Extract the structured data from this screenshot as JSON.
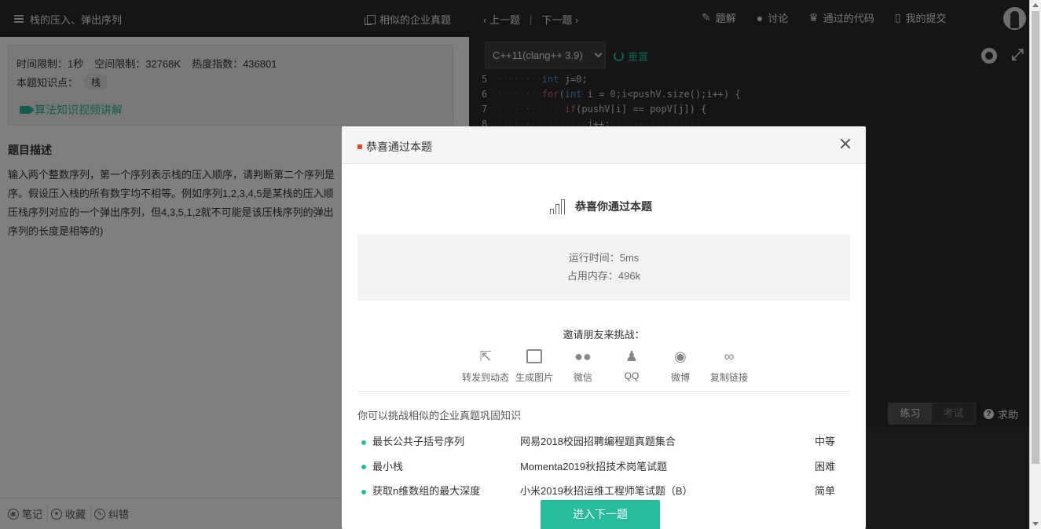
{
  "header": {
    "problem_title": "栈的压入、弹出序列",
    "similar_label": "相似的企业真题",
    "prev_label": "上一题",
    "next_label": "下一题",
    "nav": [
      {
        "label": "题解",
        "icon": "edit-icon"
      },
      {
        "label": "讨论",
        "icon": "chat-icon"
      },
      {
        "label": "通过的代码",
        "icon": "trophy-icon"
      },
      {
        "label": "我的提交",
        "icon": "document-icon"
      }
    ]
  },
  "problem": {
    "time_limit": "时间限制：1秒",
    "space_limit": "空间限制：32768K",
    "heat": "热度指数：436801",
    "knowledge_label": "本题知识点：",
    "knowledge_tag": "栈",
    "video_link": "算法知识视频讲解",
    "desc_title": "题目描述",
    "desc_lines": [
      "输入两个整数序列，第一个序列表示栈的压入顺序，请判断第二个序列是",
      "序。假设压入栈的所有数字均不相等。例如序列1,2,3,4,5是某栈的压入顺",
      "压栈序列对应的一个弹出序列，但4,3,5,1,2就不可能是该压栈序列的弹出",
      "序列的长度是相等的)"
    ]
  },
  "bottom_bar": {
    "note": "笔记",
    "favorite": "收藏",
    "report": "纠错"
  },
  "editor": {
    "language": "C++11(clang++ 3.9)",
    "reset_label": "重置",
    "line_numbers": [
      "5",
      "6",
      "7",
      "8"
    ],
    "practice_label": "练习",
    "exam_label": "考试",
    "help_label": "求助"
  },
  "modal": {
    "title": "恭喜通过本题",
    "success_text": "恭喜你通过本题",
    "runtime": "运行时间：5ms",
    "memory": "占用内存：496k",
    "invite_text": "邀请朋友来挑战：",
    "share": [
      {
        "label": "转发到动态",
        "icon": "share-external-icon"
      },
      {
        "label": "生成图片",
        "icon": "image-icon"
      },
      {
        "label": "微信",
        "icon": "wechat-icon"
      },
      {
        "label": "QQ",
        "icon": "qq-icon"
      },
      {
        "label": "微博",
        "icon": "weibo-icon"
      },
      {
        "label": "复制链接",
        "icon": "link-icon"
      }
    ],
    "similar_title": "你可以挑战相似的企业真题巩固知识",
    "similar": [
      {
        "name": "最长公共子括号序列",
        "source": "网易2018校园招聘编程题真题集合",
        "level": "中等"
      },
      {
        "name": "最小栈",
        "source": "Momenta2019秋招技术岗笔试题",
        "level": "困难"
      },
      {
        "name": "获取n维数组的最大深度",
        "source": "小米2019秋招运维工程师笔试题（B）",
        "level": "简单"
      }
    ],
    "next_button": "进入下一题"
  },
  "colors": {
    "accent": "#25bb9b",
    "topbar": "#2b2b2b",
    "title_marker": "#e44d26"
  }
}
